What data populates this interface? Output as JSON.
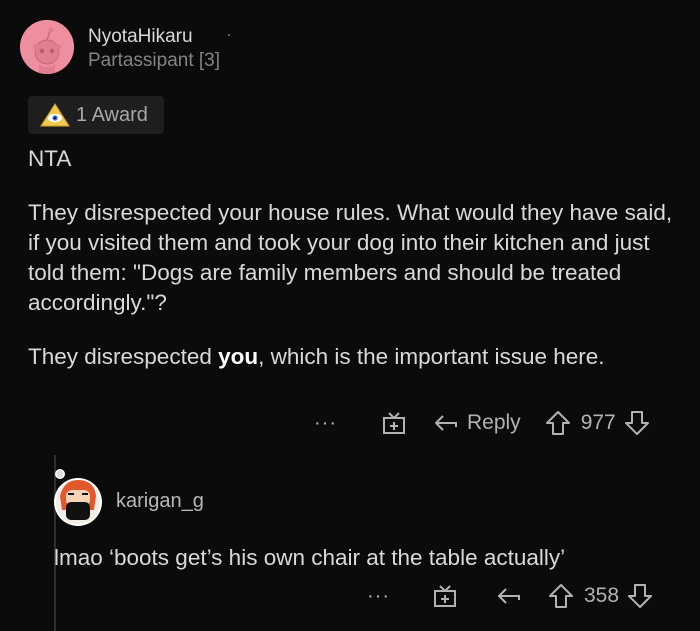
{
  "comment": {
    "username": "NyotaHikaru",
    "separator": "·",
    "flair": "Partassipant [3]",
    "award_label": "1 Award",
    "paragraphs": {
      "p1": "NTA",
      "p2": "They disrespected your house rules. What would they have said, if you visited them and took your dog into their kitchen and just told them: \"Dogs are family members and should be treated accordingly.\"?",
      "p3_before": "They disrespected ",
      "p3_bold": "you",
      "p3_after": ", which is the important issue here."
    },
    "actions": {
      "more": "···",
      "reply": "Reply",
      "score": "977"
    }
  },
  "reply": {
    "username": "karigan_g",
    "text": "lmao ‘boots get’s his own chair at the table actually’",
    "actions": {
      "more": "···",
      "score": "358"
    }
  },
  "colors": {
    "background": "#0b0b0b",
    "text": "#d7dadc",
    "muted": "#818384",
    "avatar": "#ee8f9f"
  }
}
